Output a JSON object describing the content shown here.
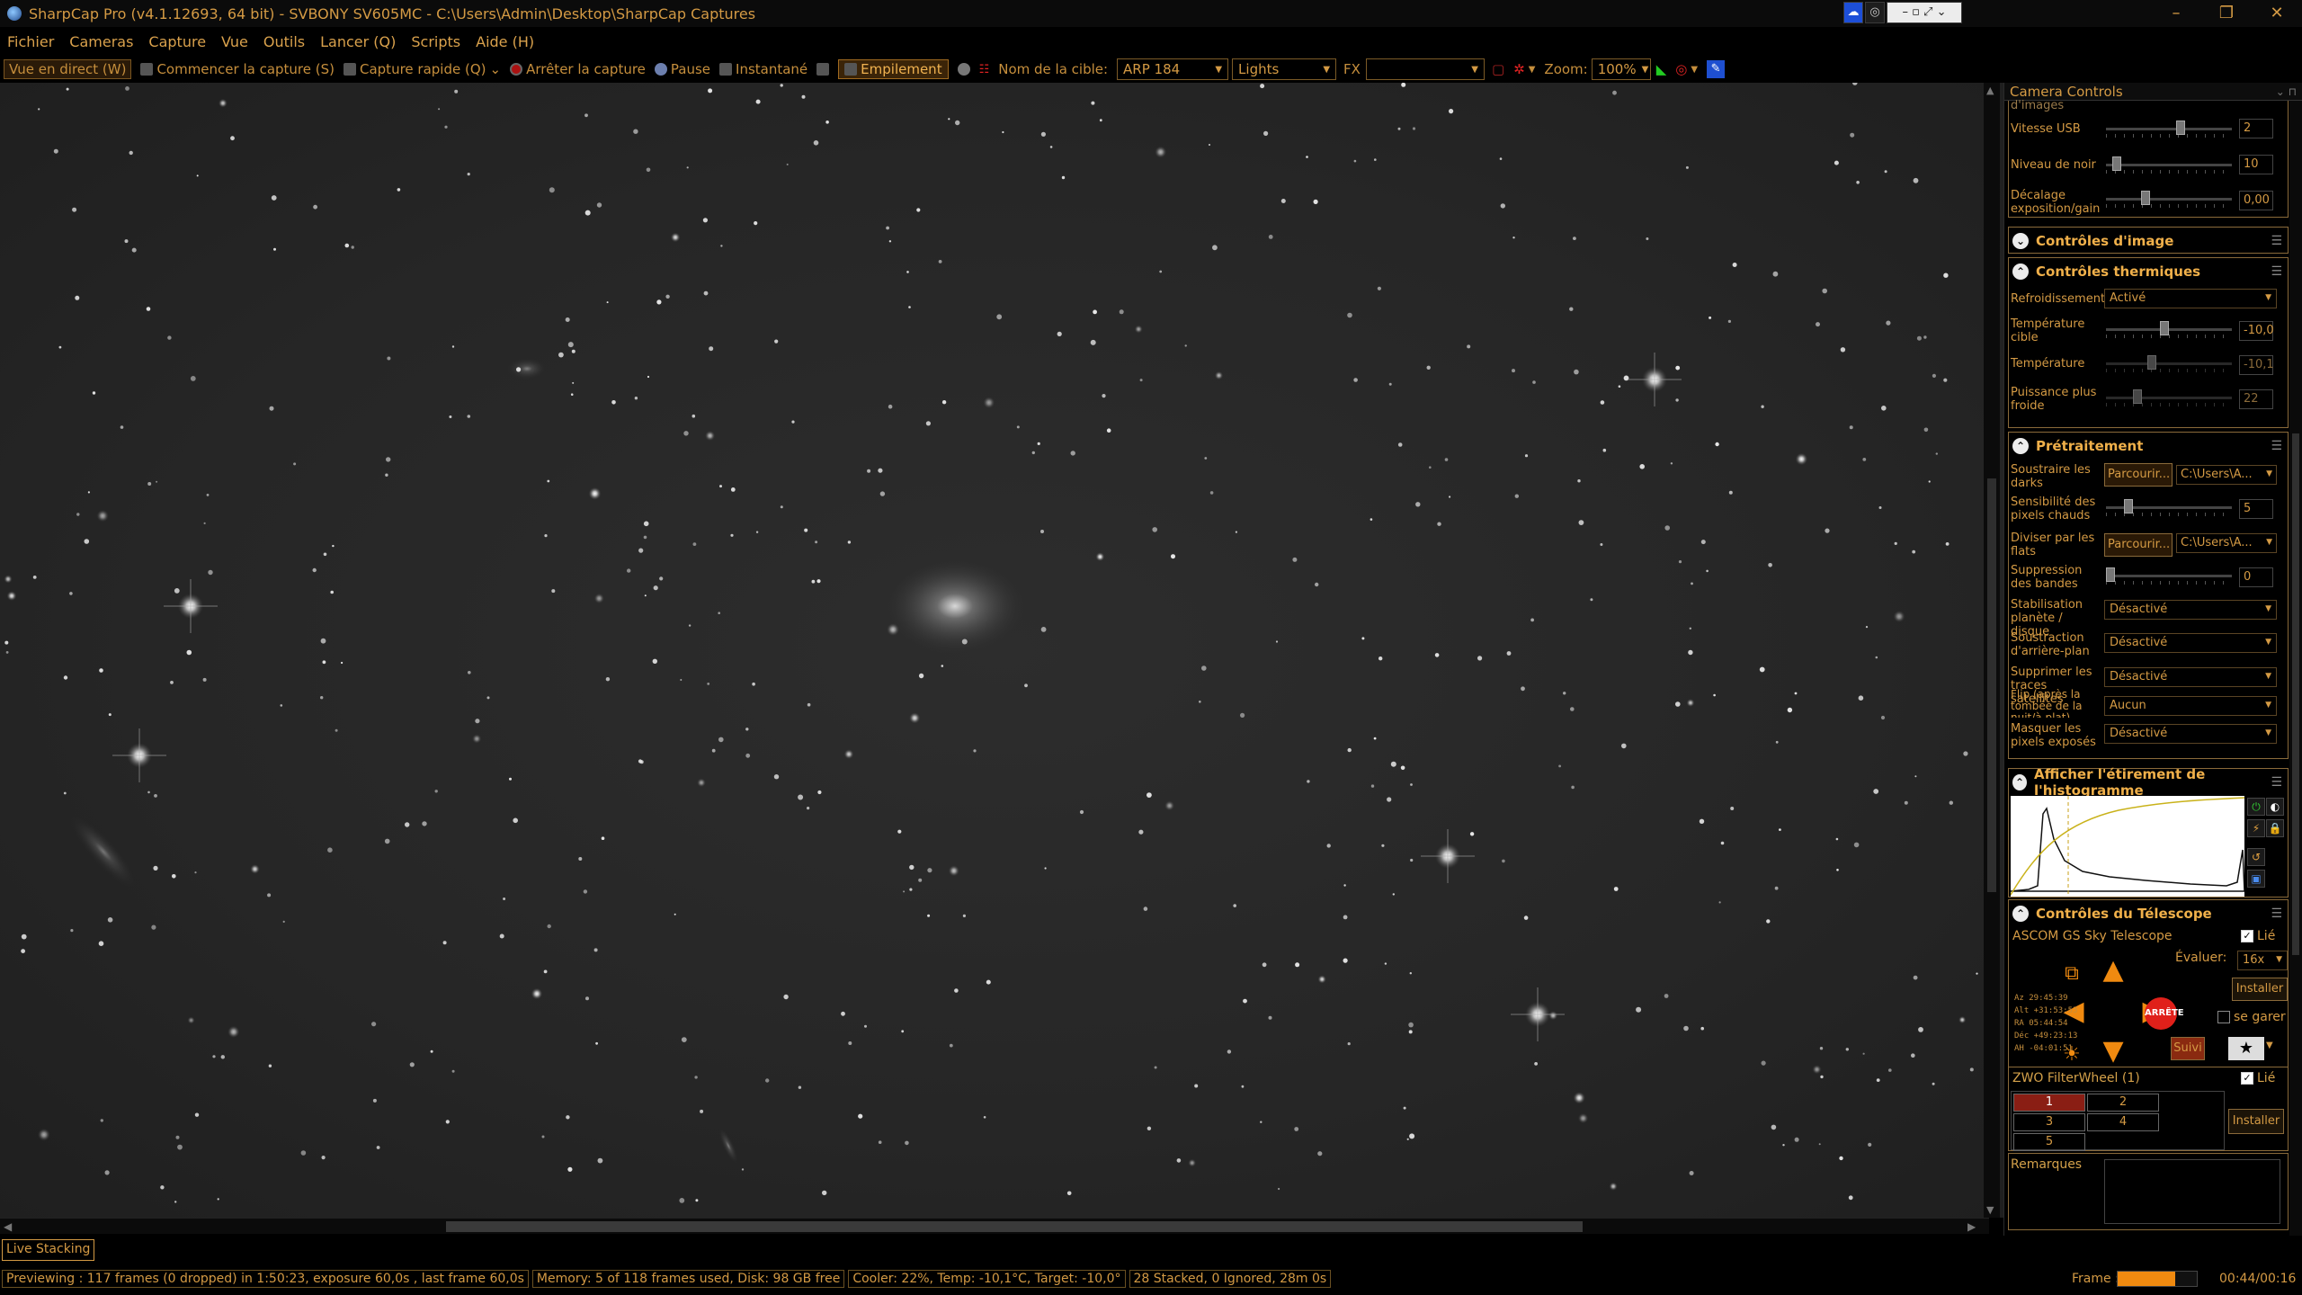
{
  "window": {
    "title": "SharpCap Pro (v4.1.12693, 64 bit) - SVBONY SV605MC - C:\\Users\\Admin\\Desktop\\SharpCap Captures"
  },
  "menu": [
    "Fichier",
    "Cameras",
    "Capture",
    "Vue",
    "Outils",
    "Lancer (Q)",
    "Scripts",
    "Aide (H)"
  ],
  "toolbar": {
    "live_view": "Vue en direct (W)",
    "start_capture": "Commencer la capture (S)",
    "quick_capture": "Capture rapide (Q)",
    "stop_capture": "Arrêter la capture",
    "pause": "Pause",
    "snapshot": "Instantané",
    "stacking": "Empilement",
    "target_label": "Nom de la cible:",
    "target_value": "ARP 184",
    "frame_type": "Lights",
    "fx_label": "FX",
    "fx_value": "",
    "zoom_label": "Zoom:",
    "zoom_value": "100%"
  },
  "panel": {
    "title": "Camera Controls",
    "top_truncated": "d'images",
    "usb_speed": {
      "label": "Vitesse USB",
      "value": "2",
      "level": 0.6
    },
    "black_level": {
      "label": "Niveau de noir",
      "value": "10",
      "level": 0.05
    },
    "exposure_offset": {
      "label": "Décalage exposition/gain",
      "value": "0,00",
      "level": 0.3
    },
    "image_controls": "Contrôles d'image",
    "thermal": {
      "title": "Contrôles thermiques",
      "cooling_label": "Refroidissement",
      "cooling_value": "Activé",
      "target_temp_label": "Température cible",
      "target_temp_value": "-10,0",
      "temp_label": "Température",
      "temp_value": "-10,1",
      "power_label": "Puissance plus froide",
      "power_value": "22"
    },
    "preprocessing": {
      "title": "Prétraitement",
      "darks_label": "Soustraire les darks",
      "browse": "Parcourir...",
      "darks_path": "C:\\Users\\A...",
      "hotpix_label": "Sensibilité des pixels chauds",
      "hotpix_value": "5",
      "flats_label": "Diviser par les flats",
      "flats_path": "C:\\Users\\A...",
      "banding_label": "Suppression des bandes",
      "banding_value": "0",
      "stab_label": "Stabilisation planète / disque",
      "stab_value": "Désactivé",
      "bg_label": "Soustraction d'arrière-plan",
      "bg_value": "Désactivé",
      "sat_label": "Supprimer les traces satellites",
      "sat_value": "Désactivé",
      "flip_label": "Flip (après la tombée de la nuit/à plat)",
      "flip_value": "Aucun",
      "mask_label": "Masquer les pixels exposés",
      "mask_value": "Désactivé"
    },
    "histogram": {
      "title": "Afficher l'étirement de l'histogramme"
    },
    "telescope": {
      "title": "Contrôles du Télescope",
      "device": "ASCOM GS Sky Telescope",
      "linked": "Lié",
      "rate_label": "Évaluer:",
      "rate_value": "16x",
      "stop": "ARRÊTE",
      "setup": "Installer",
      "park": "se garer",
      "track": "Suivi",
      "coords": [
        "Az   29:45:39",
        "Alt  +31:53:53",
        "RA   05:44:54",
        "Déc  +49:23:13",
        "AH   -04:01:51"
      ]
    },
    "filterwheel": {
      "title": "ZWO FilterWheel (1)",
      "linked": "Lié",
      "slots": [
        "1",
        "2",
        "3",
        "4",
        "5"
      ],
      "setup": "Installer"
    },
    "notes": "Remarques"
  },
  "status": {
    "live_stacking": "Live Stacking",
    "preview": "Previewing : 117 frames (0 dropped) in 1:50:23, exposure 60,0s , last frame 60,0s",
    "memory": "Memory: 5 of 118 frames used, Disk: 98 GB free",
    "cooler": "Cooler: 22%, Temp: -10,1°C, Target: -10,0°",
    "stacked": "28 Stacked, 0 Ignored, 28m 0s",
    "frame_label": "Frame :",
    "frame_progress": 0.73,
    "frame_time": "00:44/00:16"
  }
}
